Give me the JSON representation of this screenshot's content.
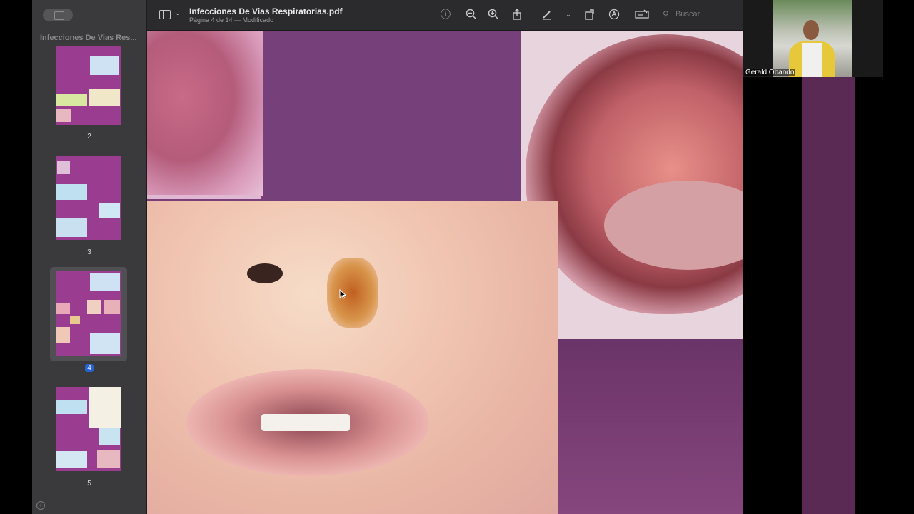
{
  "window": {
    "doc_title": "Infecciones De Vias Respiratorias.pdf",
    "doc_subtitle": "Página 4 de 14 — Modificado"
  },
  "sidebar": {
    "title": "Infecciones De Vias Res...",
    "pages": [
      {
        "label": "2",
        "selected": false
      },
      {
        "label": "3",
        "selected": false
      },
      {
        "label": "4",
        "selected": true
      },
      {
        "label": "5",
        "selected": false
      }
    ]
  },
  "toolbar": {
    "icons": [
      "sidebar-icon",
      "info-icon",
      "zoom-out-icon",
      "zoom-in-icon",
      "share-icon",
      "highlighter-icon",
      "rotate-icon",
      "markup-icon",
      "form-icon"
    ],
    "search_placeholder": "Buscar"
  },
  "webcam": {
    "participant_name": "Gerald Obando"
  },
  "colors": {
    "slide_purple": "#7a3f78",
    "selection_blue": "#2463d1"
  }
}
